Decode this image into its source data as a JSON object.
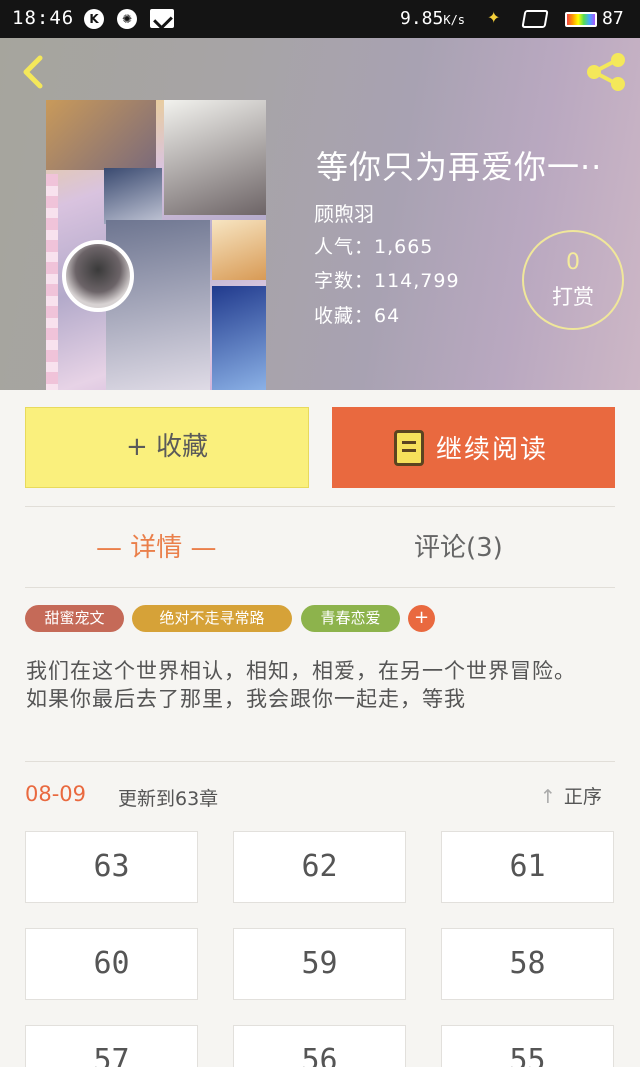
{
  "status_bar": {
    "time": "18:46",
    "speed": "9.85",
    "speed_unit": "K/s",
    "battery": "87"
  },
  "book": {
    "title": "等你只为再爱你一··",
    "author": "顾煦羽",
    "popularity": "人气：1,665",
    "word_count": "字数：114,799",
    "favorites": "收藏：64"
  },
  "reward": {
    "count": "0",
    "label": "打赏"
  },
  "actions": {
    "favorite_label": "+ 收藏",
    "continue_label": "继续阅读"
  },
  "tabs": {
    "details": "— 详情 —",
    "comments": "评论(3)"
  },
  "tags": [
    {
      "label": "甜蜜宠文",
      "color": "#c56a58"
    },
    {
      "label": "绝对不走寻常路",
      "color": "#d6a238"
    },
    {
      "label": "青春恋爱",
      "color": "#8db34c"
    }
  ],
  "tag_add": "+",
  "description": "我们在这个世界相认，相知，相爱，在另一个世界冒险。如果你最后去了那里，我会跟你一起走，等我",
  "update": {
    "date": "08-09",
    "text": "更新到63章"
  },
  "sort": {
    "arrow": "↑",
    "label": "正序"
  },
  "chapters": [
    "63",
    "62",
    "61",
    "60",
    "59",
    "58",
    "57",
    "56",
    "55"
  ]
}
